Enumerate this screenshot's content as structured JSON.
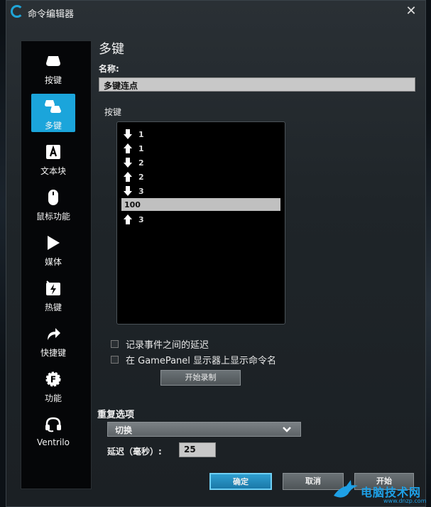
{
  "window": {
    "title": "命令编辑器"
  },
  "sidebar": {
    "items": [
      {
        "label": "按键",
        "icon": "key-icon"
      },
      {
        "label": "多键",
        "icon": "multi-key-icon",
        "active": true
      },
      {
        "label": "文本块",
        "icon": "text-block-icon"
      },
      {
        "label": "鼠标功能",
        "icon": "mouse-icon"
      },
      {
        "label": "媒体",
        "icon": "play-icon"
      },
      {
        "label": "热键",
        "icon": "hotkey-icon"
      },
      {
        "label": "快捷键",
        "icon": "shortcut-arrow-icon"
      },
      {
        "label": "功能",
        "icon": "function-icon"
      },
      {
        "label": "Ventrilo",
        "icon": "headset-icon"
      }
    ]
  },
  "main": {
    "heading": "多键",
    "name_label": "名称:",
    "name_value": "多键连点",
    "keys_label": "按键",
    "keys": [
      {
        "dir": "down",
        "key": "1"
      },
      {
        "dir": "up",
        "key": "1"
      },
      {
        "dir": "down",
        "key": "2"
      },
      {
        "dir": "up",
        "key": "2"
      },
      {
        "dir": "down",
        "key": "3"
      },
      {
        "dir": "delay",
        "key": "100"
      },
      {
        "dir": "up",
        "key": "3"
      }
    ],
    "checkbox_record_delay": "记录事件之间的延迟",
    "checkbox_gamepanel": "在 GamePanel 显示器上显示命令名",
    "record_button": "开始录制",
    "repeat_label": "重复选项",
    "repeat_value": "切换",
    "delay_label": "延迟（毫秒）:",
    "delay_value": "25"
  },
  "footer": {
    "ok": "确定",
    "cancel": "取消",
    "apply": "开始"
  },
  "watermark": {
    "text": "电脑技术网",
    "url": "www.dnzp.com"
  },
  "colors": {
    "accent": "#1ba5db"
  }
}
